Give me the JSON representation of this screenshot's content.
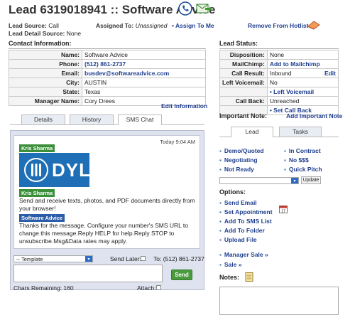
{
  "header": {
    "title": "Lead 6319018941 :: Software Advice",
    "lead_source_label": "Lead Source:",
    "lead_source_value": "Call",
    "assigned_label": "Assigned To:",
    "assigned_value": "Unassigned",
    "assign_link": "Assign To Me",
    "remove_hotlist": "Remove From Hotlist",
    "detail_source_label": "Lead Detail Source:",
    "detail_source_value": "None"
  },
  "contact": {
    "heading": "Contact Information:",
    "rows": [
      {
        "k": "Name:",
        "v": "Software Advice"
      },
      {
        "k": "Phone:",
        "v": "(512) 861-2737"
      },
      {
        "k": "Email:",
        "v": "busdev@softwareadvice.com"
      },
      {
        "k": "City:",
        "v": "AUSTIN"
      },
      {
        "k": "State:",
        "v": "Texas"
      },
      {
        "k": "Manager Name:",
        "v": "Cory Drees"
      }
    ],
    "edit_link": "Edit Information"
  },
  "tabs": {
    "details": "Details",
    "history": "History",
    "sms": "SMS Chat"
  },
  "chat": {
    "timestamp": "Today 9:04 AM",
    "sender1": "Kris Sharma",
    "logo_text": "DYL",
    "sender2": "Kris Sharma",
    "msg2": "Send and receive texts, photos, and PDF documents directly from your browser!",
    "sender3": "Software Advice",
    "msg3": "Thanks for the message. Configure your number's SMS URL to change this message.Reply HELP for help.Reply STOP to unsubscribe.Msg&Data rates may apply.",
    "template_placeholder": "-- Template",
    "send_later": "Send Later:",
    "to_label": "To: (512) 861-2737",
    "send_button": "Send",
    "chars_remaining": "Chars Remaining: 160",
    "attach": "Attach:"
  },
  "status": {
    "heading": "Lead Status:",
    "rows": [
      {
        "k": "Disposition:",
        "v": "None",
        "link": ""
      },
      {
        "k": "MailChimp:",
        "v": "",
        "link": "Add to Mailchimp"
      },
      {
        "k": "Call Result:",
        "v": "Inbound",
        "link": "Edit"
      },
      {
        "k": "Left Voicemail:",
        "v": "No",
        "link": ""
      },
      {
        "k": "",
        "v": "",
        "link": "• Left Voicemail"
      },
      {
        "k": "Call Back:",
        "v": "Unreached",
        "link": ""
      },
      {
        "k": "",
        "v": "",
        "link": "• Set Call Back"
      }
    ]
  },
  "important": {
    "heading": "Important Note:",
    "add_link": "Add Important Note"
  },
  "lead_tabs": {
    "lead": "Lead",
    "tasks": "Tasks"
  },
  "lead_stages": {
    "left": [
      "Demo/Quoted",
      "Negotiating",
      "Not Ready"
    ],
    "right": [
      "In Contract",
      "No $$$",
      "Quick Pitch"
    ]
  },
  "update_button": "Update",
  "options": {
    "heading": "Options:",
    "items": [
      "Send Email",
      "Set Appointment",
      "Add To SMS List",
      "Add To Folder",
      "Upload File"
    ],
    "manager_sale": "Manager Sale »",
    "sale": "Sale »"
  },
  "notes": {
    "heading": "Notes:"
  },
  "colors": {
    "accent_green": "#4a9a3e",
    "link_blue": "#1f3f8f",
    "panel": "#dfe3ef"
  }
}
